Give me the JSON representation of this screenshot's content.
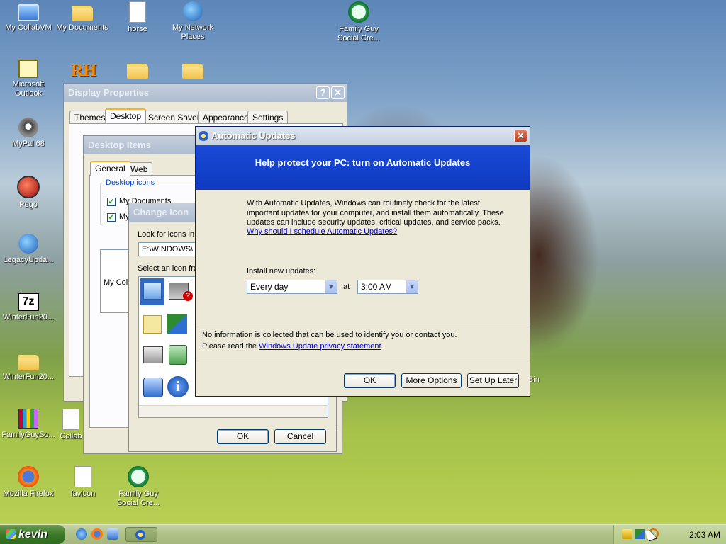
{
  "desktop_icons": [
    {
      "label": "My CollabVM",
      "icon": "computer-icon"
    },
    {
      "label": "My Documents",
      "icon": "folder-icon"
    },
    {
      "label": "horse",
      "icon": "document-icon"
    },
    {
      "label": "My Network Places",
      "icon": "globe-icon"
    },
    {
      "label": "Family Guy Social Cre...",
      "icon": "play-icon"
    },
    {
      "label": "Microsoft Outlook",
      "icon": "outlook-icon"
    },
    {
      "label": "",
      "icon": "rh-icon",
      "glyph": "RH"
    },
    {
      "label": "",
      "icon": "folder-icon"
    },
    {
      "label": "",
      "icon": "folder-icon"
    },
    {
      "label": "MyPal 68",
      "icon": "raccoon-icon"
    },
    {
      "label": "Pego",
      "icon": "red-ball-icon"
    },
    {
      "label": "LegacyUpda...",
      "icon": "globe-icon"
    },
    {
      "label": "WinterFun20...",
      "icon": "7z-icon",
      "glyph": "7z"
    },
    {
      "label": "WinterFun20...",
      "icon": "folder-icon"
    },
    {
      "label": "FamilyGuySo...",
      "icon": "winrar-icon"
    },
    {
      "label": "Collab",
      "icon": "document-icon"
    },
    {
      "label": "Mozilla Firefox",
      "icon": "firefox-icon"
    },
    {
      "label": "favicon",
      "icon": "document-icon"
    },
    {
      "label": "Family Guy Social Cre...",
      "icon": "play-icon"
    },
    {
      "label": "Bin",
      "icon": "recycle-bin-icon"
    }
  ],
  "display_properties": {
    "title": "Display Properties",
    "tabs": [
      "Themes",
      "Desktop",
      "Screen Saver",
      "Appearance",
      "Settings"
    ],
    "selected_tab": "Desktop"
  },
  "desktop_items": {
    "title": "Desktop Items",
    "tabs": [
      "General",
      "Web"
    ],
    "group_label": "Desktop icons",
    "checkboxes": [
      "My Documents",
      "My"
    ],
    "preview_label": "My Col"
  },
  "change_icon": {
    "title": "Change Icon",
    "look_label": "Look for icons in",
    "path_value": "E:\\WINDOWS\\",
    "select_label": "Select an icon fro",
    "ok": "OK",
    "cancel": "Cancel"
  },
  "auto_updates": {
    "title": "Automatic Updates",
    "header": "Help protect your PC: turn on Automatic Updates",
    "body": "With Automatic Updates, Windows can routinely check for the latest important updates for your computer, and install them automatically. These updates can include security updates, critical updates, and service packs.",
    "why_link": "Why should I schedule Automatic Updates?",
    "install_label": "Install new updates:",
    "frequency": "Every day",
    "at_label": "at",
    "time": "3:00 AM",
    "privacy_line1": "No information is collected that can be used to identify you or contact you.",
    "privacy_prefix": "Please read the",
    "privacy_link": "Windows Update privacy statement",
    "privacy_suffix": ".",
    "ok": "OK",
    "more": "More Options",
    "later": "Set Up Later"
  },
  "taskbar": {
    "start_label": "kevin",
    "clock": "2:03 AM"
  }
}
